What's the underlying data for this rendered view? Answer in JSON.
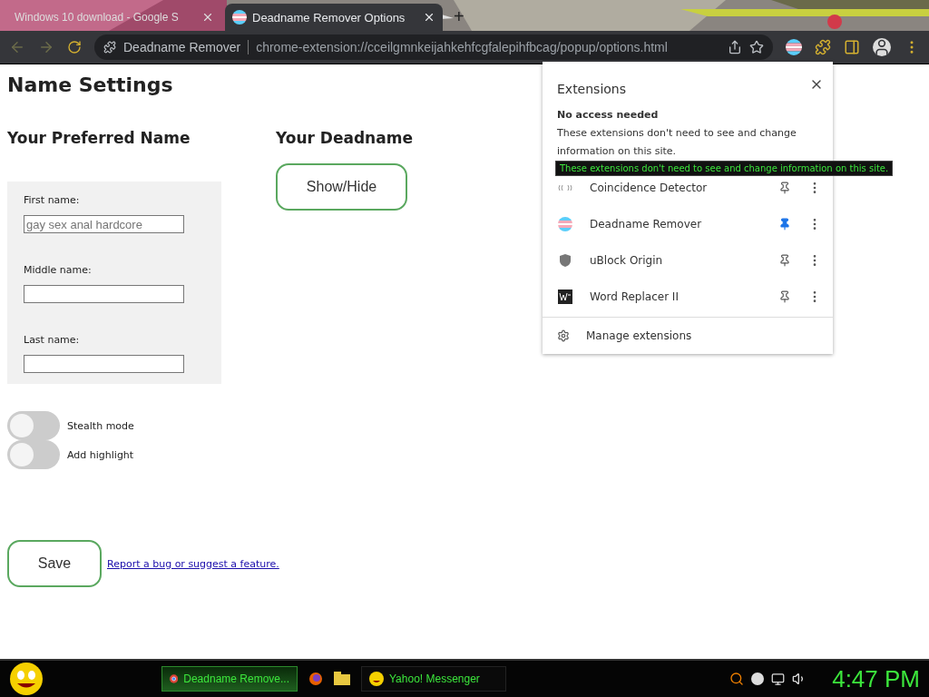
{
  "tabs": [
    {
      "title": "Windows 10 download - Google S",
      "selected": false
    },
    {
      "title": "Deadname Remover Options",
      "selected": true
    }
  ],
  "new_tab": "+",
  "address_bar": {
    "site": "Deadname Remover",
    "url": "chrome-extension://cceilgmnkeijahkehfcgfalepihfbcag/popup/options.html"
  },
  "page": {
    "title": "Name Settings",
    "preferred_heading": "Your Preferred Name",
    "deadname_heading": "Your Deadname",
    "show_hide_button": "Show/Hide",
    "fields": [
      {
        "label": "First name:",
        "placeholder": "gay sex anal hardcore"
      },
      {
        "label": "Middle name:"
      },
      {
        "label": "Last name:"
      }
    ],
    "toggles": [
      {
        "label": "Stealth mode",
        "on": false
      },
      {
        "label": "Add highlight",
        "on": false
      }
    ],
    "save_button": "Save",
    "report_link": "Report a bug or suggest a feature."
  },
  "extensions_popup": {
    "title": "Extensions",
    "section": "No access needed",
    "description": "These extensions don't need to see and change information on this site.",
    "tooltip": "These extensions don't need to see and change information on this site.",
    "items": [
      {
        "name": "Coincidence Detector",
        "pinned": false
      },
      {
        "name": "Deadname Remover",
        "pinned": true
      },
      {
        "name": "uBlock Origin",
        "pinned": false
      },
      {
        "name": "Word Replacer II",
        "pinned": false
      }
    ],
    "manage": "Manage extensions"
  },
  "taskbar": {
    "windows": [
      {
        "label": "Deadname Remove...",
        "selected": true
      },
      {
        "label": "Yahoo! Messenger",
        "selected": false
      }
    ],
    "clock": "4:47 PM"
  }
}
